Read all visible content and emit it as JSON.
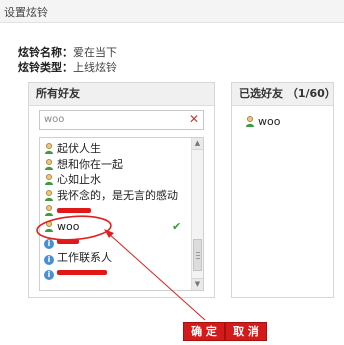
{
  "window": {
    "title": "设置炫铃"
  },
  "info": {
    "name_label": "炫铃名称：",
    "name_value": "爱在当下",
    "type_label": "炫铃类型：",
    "type_value": "上线炫铃"
  },
  "all_friends": {
    "title": "所有好友",
    "search": {
      "value": "woo",
      "placeholder": ""
    },
    "items": [
      {
        "label": "起伏人生",
        "icon": "user-icon"
      },
      {
        "label": "想和你在一起",
        "icon": "user-icon"
      },
      {
        "label": "心如止水",
        "icon": "user-icon"
      },
      {
        "label": "我怀念的，是无言的感动",
        "icon": "user-icon"
      },
      {
        "label": "",
        "icon": "user-icon",
        "redacted": true
      },
      {
        "label": "woo",
        "icon": "user-icon",
        "selected": true,
        "check": "✔"
      },
      {
        "label": "",
        "icon": "contact-icon",
        "redacted": true
      },
      {
        "label": "工作联系人",
        "icon": "contact-icon"
      },
      {
        "label": "",
        "icon": "contact-icon",
        "redacted": true
      }
    ]
  },
  "selected_friends": {
    "title": "已选好友 （1/60）",
    "items": [
      {
        "label": "woo",
        "icon": "user-icon"
      }
    ]
  },
  "buttons": {
    "ok": "确 定",
    "cancel": "取 消"
  },
  "colors": {
    "accent_red": "#d31b1b",
    "check_green": "#2fa12f",
    "annotation_red": "#e02020"
  }
}
